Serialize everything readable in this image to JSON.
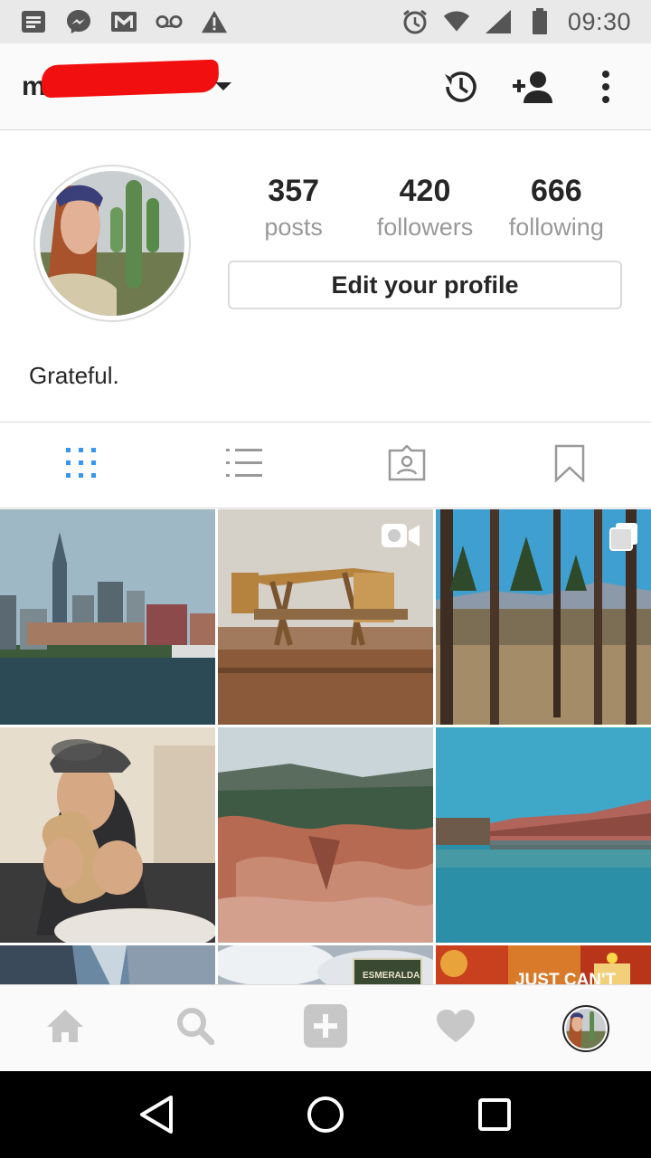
{
  "status_bar": {
    "time": "09:30",
    "left_icons": [
      "notification-icon",
      "messenger-icon",
      "gmail-icon",
      "voicemail-icon",
      "warning-icon"
    ],
    "right_icons": [
      "alarm-icon",
      "wifi-icon",
      "cell-signal-icon",
      "battery-icon"
    ]
  },
  "app_bar": {
    "username": "me",
    "actions": [
      "history-icon",
      "add-person-icon",
      "more-vert-icon"
    ]
  },
  "profile": {
    "stats": [
      {
        "value": "357",
        "label": "posts"
      },
      {
        "value": "420",
        "label": "followers"
      },
      {
        "value": "666",
        "label": "following"
      }
    ],
    "edit_button": "Edit your profile",
    "bio": "Grateful."
  },
  "tabs": [
    {
      "name": "grid-view",
      "icon": "grid-icon",
      "active": true
    },
    {
      "name": "list-view",
      "icon": "list-icon",
      "active": false
    },
    {
      "name": "tagged",
      "icon": "tagged-person-icon",
      "active": false
    },
    {
      "name": "saved",
      "icon": "bookmark-icon",
      "active": false
    }
  ],
  "posts": [
    {
      "subject": "city skyline by river",
      "badge": ""
    },
    {
      "subject": "oil pump jack",
      "badge": "video"
    },
    {
      "subject": "forest with mountains",
      "badge": "multiple"
    },
    {
      "subject": "person eating burrito",
      "badge": ""
    },
    {
      "subject": "red rock canyon",
      "badge": ""
    },
    {
      "subject": "river with red cliffs",
      "badge": ""
    },
    {
      "subject": "canyon walls",
      "badge": ""
    },
    {
      "subject": "sign under cloudy sky",
      "badge": ""
    },
    {
      "subject": "autumn candle collage",
      "badge": ""
    }
  ],
  "post_text": {
    "sign": "ESMERALDA",
    "collage": "JUST CAN'T"
  },
  "bottom_nav": [
    "home-icon",
    "search-icon",
    "add-post-icon",
    "activity-heart-icon",
    "profile-avatar"
  ],
  "system_nav": [
    "back-icon",
    "home-circle-icon",
    "recents-icon"
  ],
  "colors": {
    "accent_blue": "#3897f0",
    "text": "#262626",
    "muted": "#999999",
    "border": "#dbdbdb",
    "redaction": "#f20f0f"
  }
}
